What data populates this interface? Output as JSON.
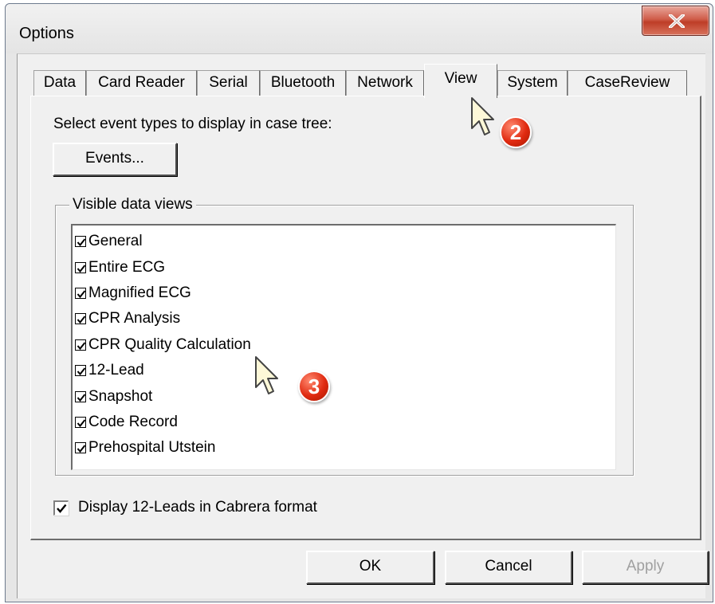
{
  "window": {
    "title": "Options"
  },
  "tabs": [
    {
      "label": "Data"
    },
    {
      "label": "Card Reader"
    },
    {
      "label": "Serial"
    },
    {
      "label": "Bluetooth"
    },
    {
      "label": "Network"
    },
    {
      "label": "View",
      "active": true
    },
    {
      "label": "System"
    },
    {
      "label": "CaseReview"
    }
  ],
  "view": {
    "event_types_label": "Select event types to display in case tree:",
    "events_button": "Events...",
    "visible_views_label": "Visible data views",
    "data_views": [
      {
        "label": "General",
        "checked": true
      },
      {
        "label": "Entire ECG",
        "checked": true
      },
      {
        "label": "Magnified ECG",
        "checked": true
      },
      {
        "label": "CPR Analysis",
        "checked": true
      },
      {
        "label": "CPR Quality Calculation",
        "checked": true
      },
      {
        "label": "12-Lead",
        "checked": true
      },
      {
        "label": "Snapshot",
        "checked": true
      },
      {
        "label": "Code Record",
        "checked": true
      },
      {
        "label": "Prehospital Utstein",
        "checked": true
      }
    ],
    "cabrera_label": "Display 12-Leads in Cabrera format",
    "cabrera_checked": true
  },
  "buttons": {
    "ok": "OK",
    "cancel": "Cancel",
    "apply": "Apply",
    "apply_enabled": false
  },
  "annotations": {
    "badge_tab": "2",
    "badge_list": "3"
  },
  "colors": {
    "close_button": "#c94a33",
    "badge": "#e02a10"
  },
  "icons": [
    "close-icon",
    "mouse-cursor-icon",
    "checkmark-icon"
  ]
}
